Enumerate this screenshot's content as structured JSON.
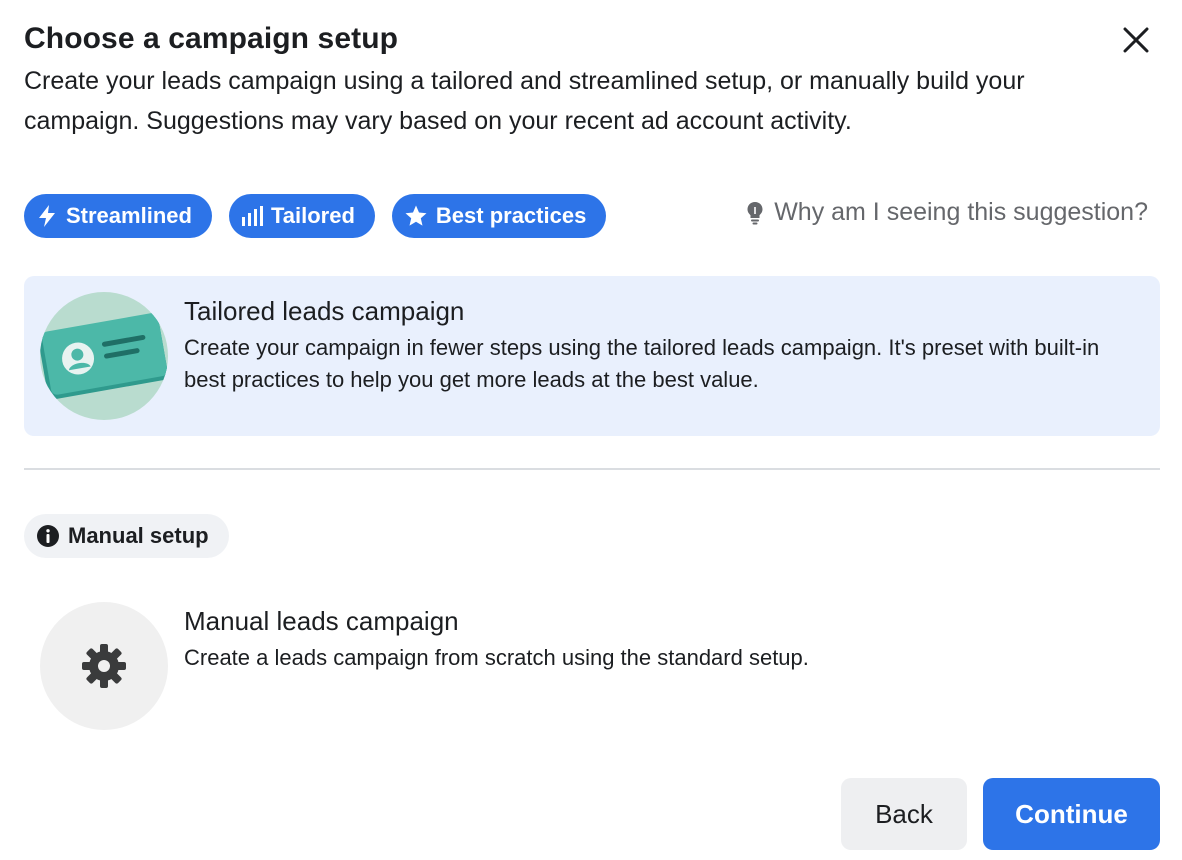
{
  "dialog": {
    "title": "Choose a campaign setup",
    "subtitle": "Create your leads campaign using a tailored and streamlined setup, or manually build your campaign. Suggestions may vary based on your recent ad account activity.",
    "close_icon": "close-icon"
  },
  "tags": [
    {
      "label": "Streamlined",
      "icon": "lightning-icon"
    },
    {
      "label": "Tailored",
      "icon": "bar-chart-icon"
    },
    {
      "label": "Best practices",
      "icon": "star-icon"
    }
  ],
  "why_link": {
    "label": "Why am I seeing this suggestion?",
    "icon": "lightbulb-icon"
  },
  "tailored_option": {
    "title": "Tailored leads campaign",
    "description": "Create your campaign in fewer steps using the tailored leads campaign. It's preset with built-in best practices to help you get more leads at the best value.",
    "icon": "contact-card-illustration"
  },
  "manual_section": {
    "badge_label": "Manual setup",
    "badge_icon": "info-icon",
    "title": "Manual leads campaign",
    "description": "Create a leads campaign from scratch using the standard setup.",
    "icon": "gear-icon"
  },
  "footer": {
    "back_label": "Back",
    "continue_label": "Continue"
  },
  "colors": {
    "accent": "#2d74e8",
    "selected_card_bg": "#e9f0fd",
    "secondary_text": "#65676b"
  }
}
